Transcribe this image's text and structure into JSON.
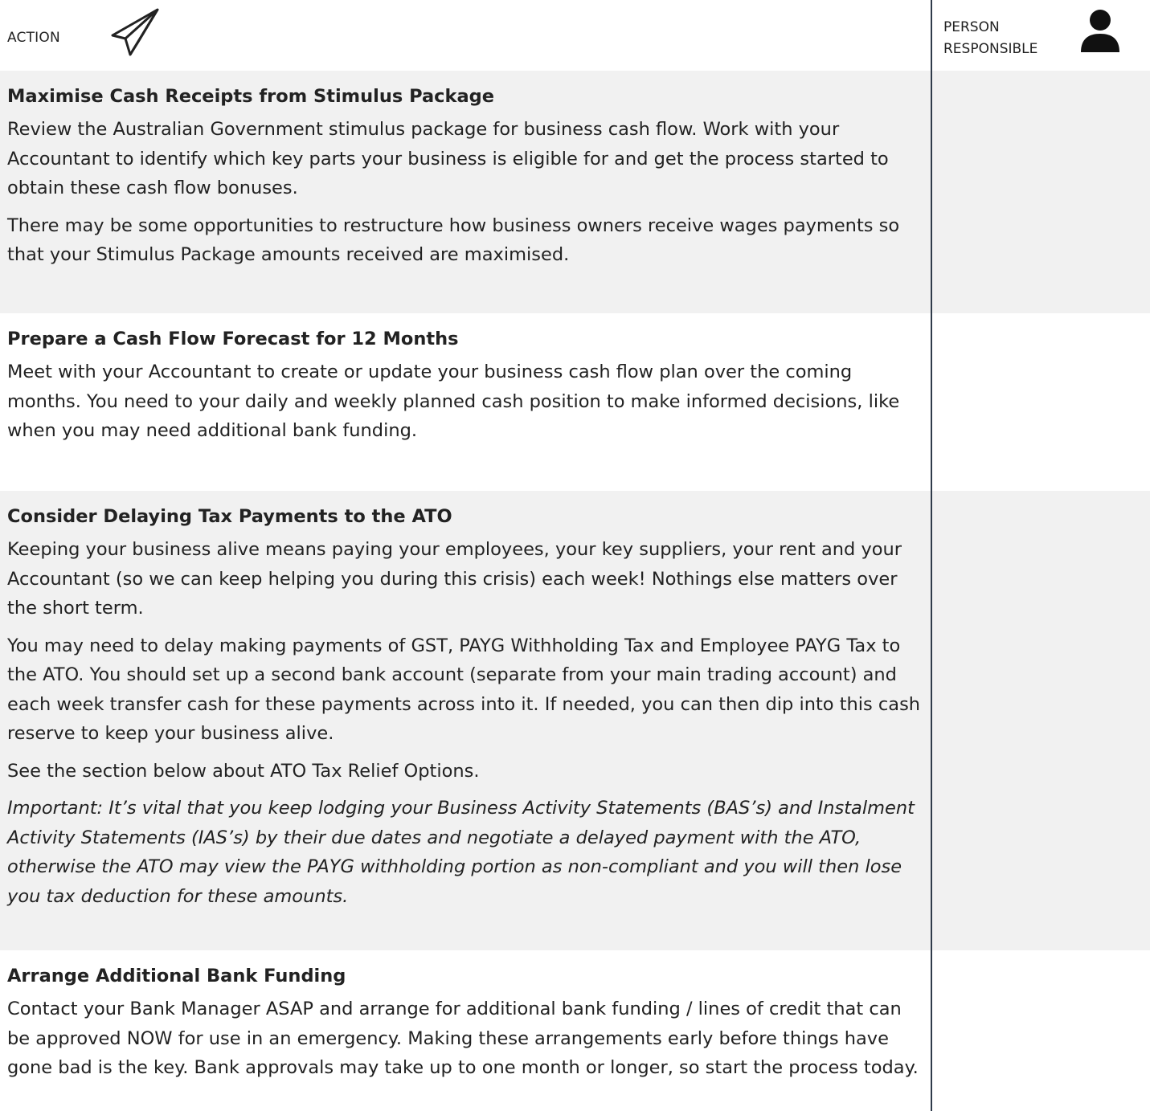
{
  "header": {
    "action_label": "ACTION",
    "action_icon": "paper-plane-icon",
    "person_label_line1": "PERSON",
    "person_label_line2": "RESPONSIBLE",
    "person_icon": "person-icon"
  },
  "colors": {
    "shaded_row": "#f1f1f1",
    "divider": "#2f3b4a",
    "text": "#222222"
  },
  "sections": [
    {
      "title": "Maximise Cash Receipts from Stimulus Package",
      "paragraphs": [
        "Review the Australian Government stimulus package for business cash flow. Work with your Accountant to identify which key parts your business is eligible for and get the process started to obtain these cash flow bonuses.",
        "There may be some opportunities to restructure how business owners receive wages payments so that your Stimulus Package amounts received are maximised."
      ]
    },
    {
      "title": "Prepare a Cash Flow Forecast for 12 Months",
      "paragraphs": [
        "Meet with your Accountant to create or update your business cash flow plan over the coming months. You need to your daily and weekly planned cash position to make informed decisions, like when you may need additional bank funding."
      ]
    },
    {
      "title": "Consider Delaying Tax Payments to the ATO",
      "paragraphs": [
        "Keeping your business alive means paying your employees, your key suppliers, your rent and your Accountant (so we can keep helping you during this crisis) each week! Nothings else matters over the short term.",
        "You may need to delay making payments of GST, PAYG Withholding Tax and Employee PAYG Tax to the ATO. You should set up a second bank account (separate from your main trading account) and each week transfer cash for these payments across into it. If needed, you can then dip into this cash reserve to keep your business alive.",
        "See the section below about ATO Tax Relief Options.",
        "Important: It’s vital that you keep lodging your Business Activity Statements (BAS’s) and Instalment Activity Statements (IAS’s) by their due dates and negotiate a delayed payment with the ATO, otherwise the ATO may view the PAYG withholding portion as non-compliant and you will then lose you tax deduction for these amounts."
      ]
    },
    {
      "title": "Arrange Additional Bank Funding",
      "paragraphs": [
        "Contact your Bank Manager ASAP and arrange for additional bank funding / lines of credit that can be approved NOW for use in an emergency. Making these arrangements early before things have gone bad is the key. Bank approvals may take up to one month or longer, so start the process today."
      ]
    }
  ]
}
